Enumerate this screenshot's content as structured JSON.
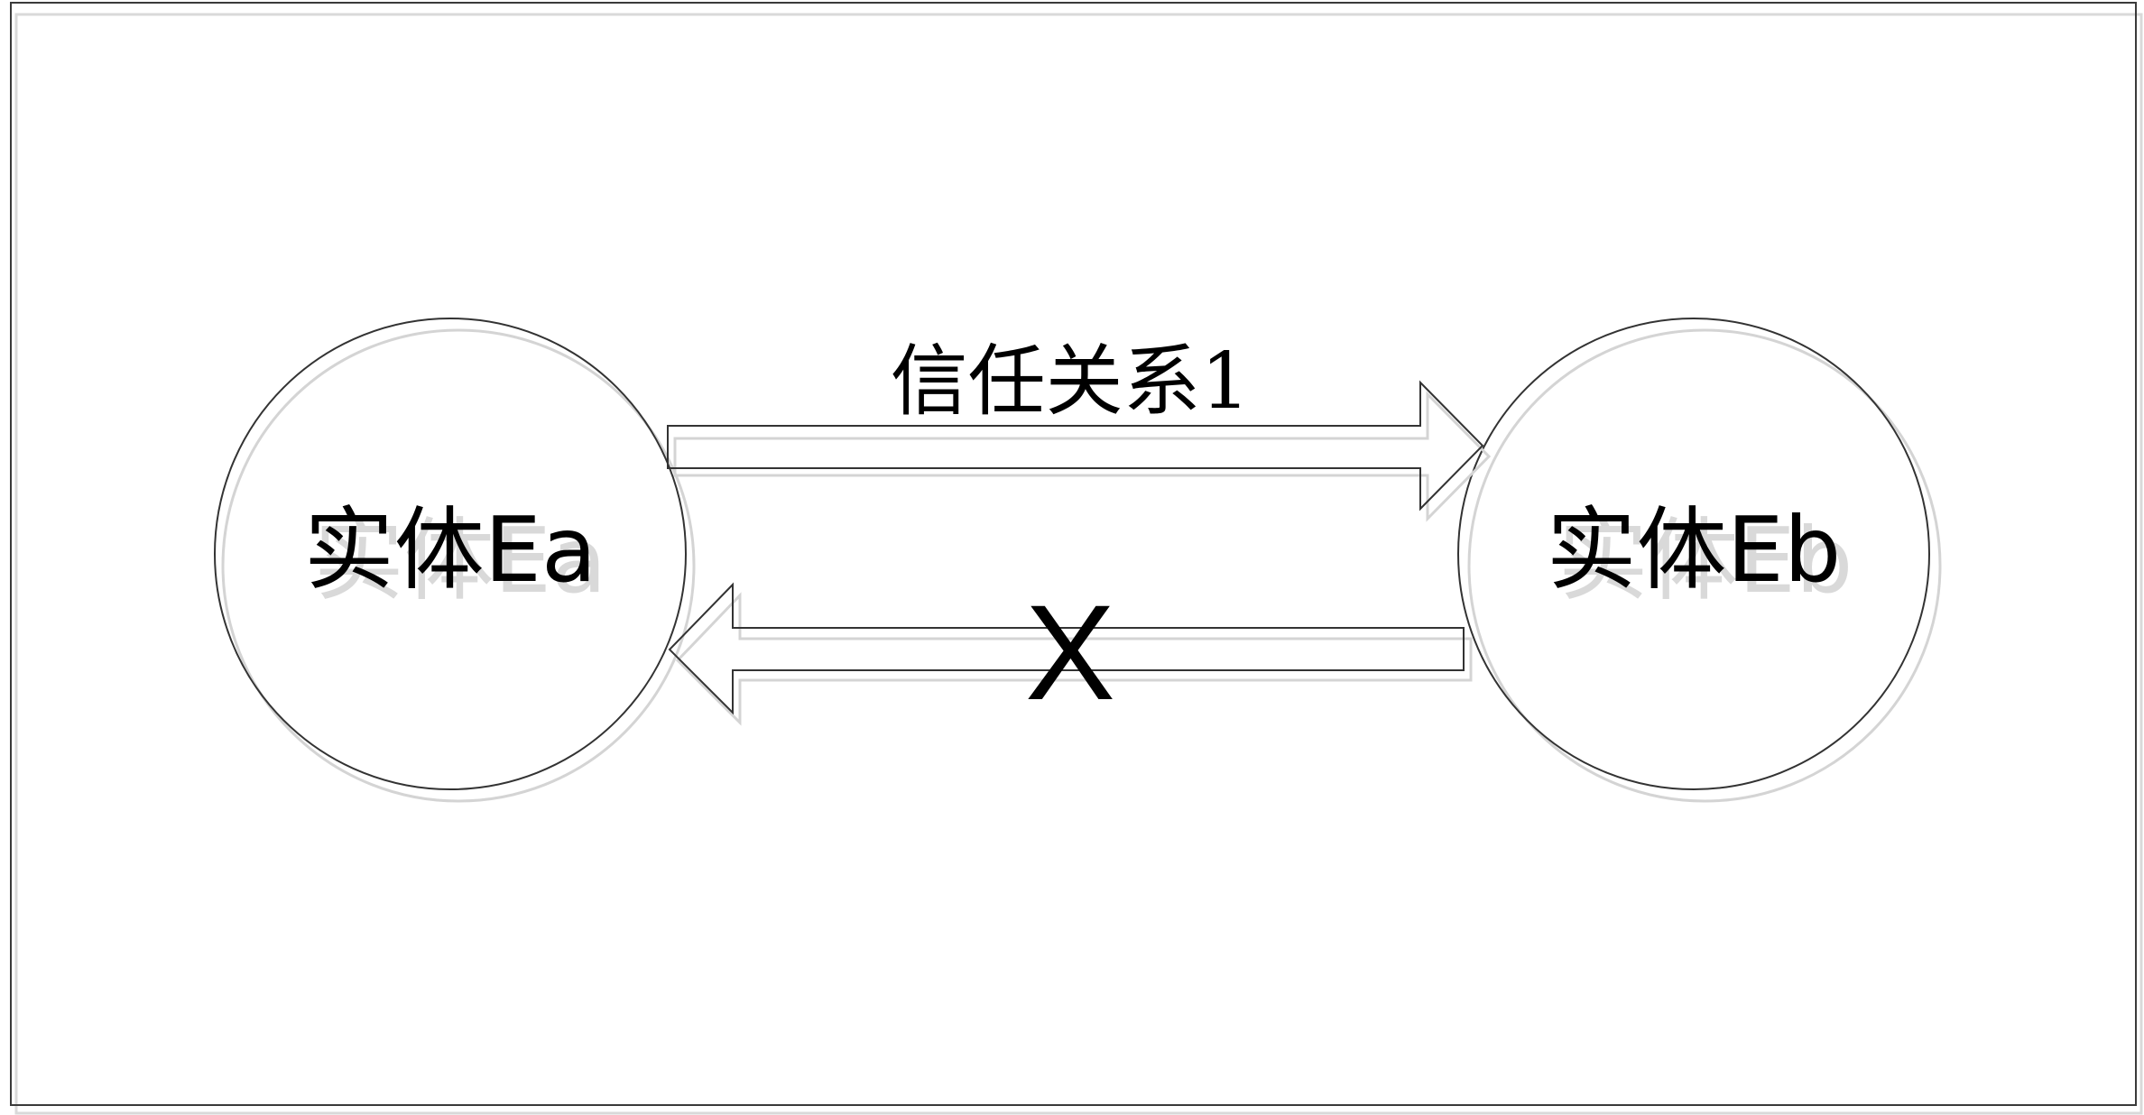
{
  "entities": {
    "a": {
      "label": "实体Ea"
    },
    "b": {
      "label": "实体Eb"
    }
  },
  "relations": {
    "forward": {
      "label": "信任关系1"
    },
    "reverse": {
      "mark": "X"
    }
  },
  "colors": {
    "stroke": "#333333",
    "shadow": "#d4d4d4",
    "text": "#000000"
  }
}
